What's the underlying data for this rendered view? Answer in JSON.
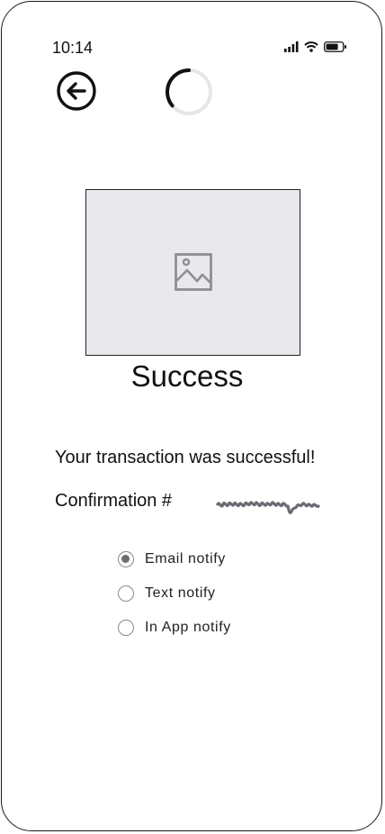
{
  "status_bar": {
    "time": "10:14",
    "icons": [
      "signal-icon",
      "wifi-icon",
      "battery-icon"
    ]
  },
  "header": {
    "back_icon": "arrow-left-circle-icon",
    "loading_icon": "spinner-icon"
  },
  "hero": {
    "image_icon": "image-placeholder-icon",
    "title": "Success"
  },
  "body": {
    "message": "Your transaction was successful!",
    "confirmation_label": "Confirmation #"
  },
  "notify_options": [
    {
      "label": "Email notify",
      "selected": true
    },
    {
      "label": "Text notify",
      "selected": false
    },
    {
      "label": "In App notify",
      "selected": false
    }
  ],
  "colors": {
    "placeholder_bg": "#e9e8ed",
    "scribble": "#6b6b73"
  }
}
